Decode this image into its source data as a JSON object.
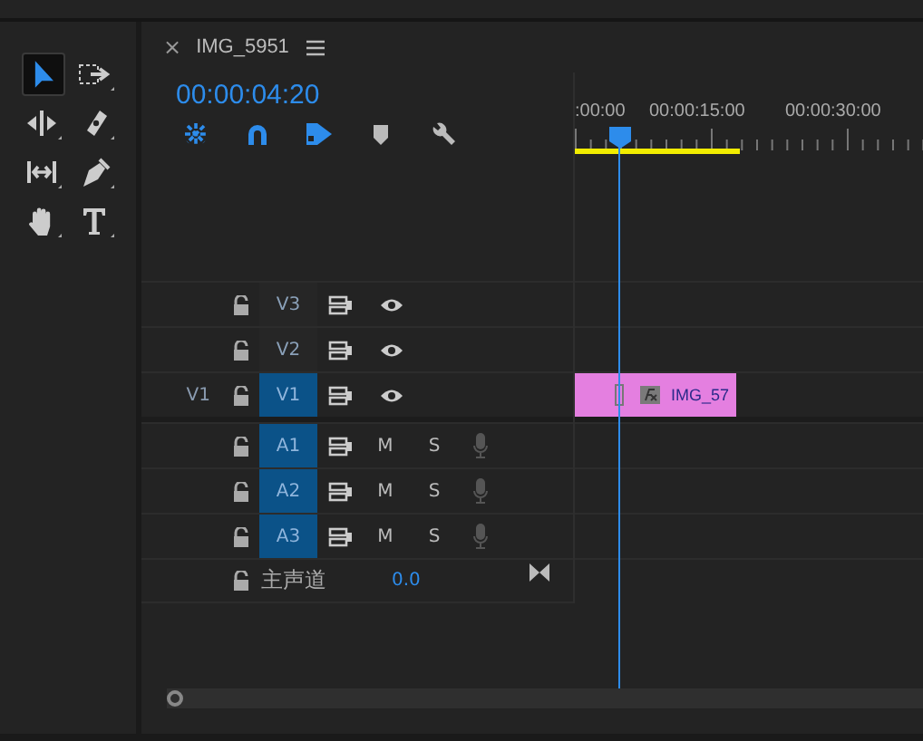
{
  "tools": [
    {
      "selected": true
    },
    {
      "selected": false
    },
    {
      "selected": false
    },
    {
      "selected": false
    },
    {
      "selected": false
    },
    {
      "selected": false
    },
    {
      "selected": false
    },
    {
      "selected": false
    }
  ],
  "sequence": {
    "close": "×",
    "title": "IMG_5951",
    "timecode": "00:00:04:20"
  },
  "toolbar": [
    {
      "on": true
    },
    {
      "on": true
    },
    {
      "on": true
    },
    {
      "on": false
    },
    {
      "on": false
    }
  ],
  "ruler": {
    "labels": [
      ":00:00",
      "00:00:15:00",
      "00:00:30:00"
    ],
    "level": 0.47
  },
  "video_tracks": [
    {
      "name": "V3",
      "targeted": false
    },
    {
      "name": "V2",
      "targeted": false
    },
    {
      "source": "V1",
      "name": "V1",
      "targeted": true,
      "clip": {
        "name": "IMG_57"
      }
    }
  ],
  "audio_tracks": [
    {
      "name": "A1",
      "targeted": true,
      "mute": "M",
      "solo": "S"
    },
    {
      "name": "A2",
      "targeted": true,
      "mute": "M",
      "solo": "S"
    },
    {
      "name": "A3",
      "targeted": true,
      "mute": "M",
      "solo": "S"
    }
  ],
  "master": {
    "label": "主声道",
    "value": "0.0"
  }
}
